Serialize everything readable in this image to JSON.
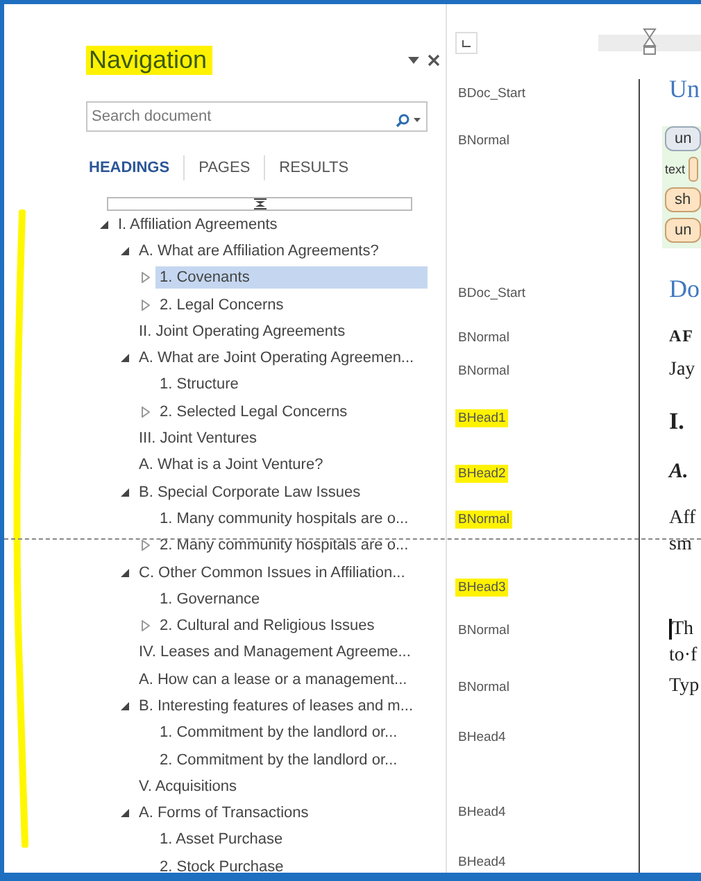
{
  "navigation": {
    "title": "Navigation",
    "title_highlighted": true,
    "search": {
      "placeholder": "Search document"
    },
    "tabs": [
      {
        "label": "HEADINGS",
        "selected": true
      },
      {
        "label": "PAGES",
        "selected": false
      },
      {
        "label": "RESULTS",
        "selected": false
      }
    ],
    "tree": [
      {
        "label": "I. Affiliation Agreements",
        "expanded": true,
        "selected": false,
        "children": [
          {
            "label": "A. What are Affiliation Agreements?",
            "expanded": true,
            "selected": false,
            "children": [
              {
                "label": "1. Covenants",
                "expanded": false,
                "selected": true
              },
              {
                "label": "2. Legal Concerns",
                "expanded": false,
                "selected": false
              }
            ]
          },
          {
            "label": "II. Joint Operating Agreements",
            "selected": false
          },
          {
            "label": "A. What are Joint Operating Agreemen...",
            "expanded": true,
            "selected": false,
            "children": [
              {
                "label": "1. Structure",
                "selected": false
              },
              {
                "label": "2. Selected Legal Concerns",
                "expanded": false,
                "selected": false
              }
            ]
          },
          {
            "label": "III. Joint Ventures",
            "selected": false
          },
          {
            "label": "A. What is a Joint Venture?",
            "selected": false
          },
          {
            "label": "B. Special Corporate Law Issues",
            "expanded": true,
            "selected": false,
            "children": [
              {
                "label": "1. Many community hospitals are o...",
                "selected": false
              },
              {
                "label": "2. Many community hospitals are o...",
                "expanded": false,
                "selected": false
              }
            ]
          },
          {
            "label": "C. Other Common Issues in Affiliation...",
            "expanded": true,
            "selected": false,
            "children": [
              {
                "label": "1. Governance",
                "selected": false
              },
              {
                "label": "2. Cultural and Religious Issues",
                "expanded": false,
                "selected": false
              }
            ]
          },
          {
            "label": "IV. Leases and Management Agreeme...",
            "selected": false
          },
          {
            "label": "A. How can a lease or a management...",
            "selected": false
          },
          {
            "label": "B. Interesting features of leases and m...",
            "expanded": true,
            "selected": false,
            "children": [
              {
                "label": "1. Commitment by the landlord or...",
                "selected": false
              },
              {
                "label": "2. Commitment by the landlord or...",
                "selected": false
              }
            ]
          },
          {
            "label": "V. Acquisitions",
            "selected": false
          },
          {
            "label": "A. Forms of Transactions",
            "expanded": true,
            "selected": false,
            "children": [
              {
                "label": "1. Asset Purchase",
                "selected": false
              },
              {
                "label": "2. Stock Purchase",
                "selected": false
              }
            ]
          }
        ]
      }
    ]
  },
  "styles_rows": [
    {
      "style": "BDoc_Start",
      "highlighted": false,
      "doc": {
        "kind": "heading",
        "lines": [
          "Un"
        ]
      }
    },
    {
      "style": "BNormal",
      "highlighted": false,
      "doc": {
        "kind": "tags",
        "tags": [
          {
            "text": "un",
            "color": "#e4e9ef"
          },
          {
            "label": "text",
            "color": "#fde3c2"
          },
          {
            "text": "sh",
            "color": "#fde3c2"
          },
          {
            "text": "un",
            "color": "#fde3c2"
          }
        ]
      }
    },
    {
      "style": "BDoc_Start",
      "highlighted": false,
      "doc": {
        "kind": "heading",
        "lines": [
          "Do"
        ]
      }
    },
    {
      "style": "BNormal",
      "highlighted": false,
      "doc": {
        "kind": "smallcaps",
        "lines": [
          "AF"
        ]
      }
    },
    {
      "style": "BNormal",
      "highlighted": false,
      "doc": {
        "kind": "body",
        "lines": [
          "Jay"
        ]
      }
    },
    {
      "style": "BHead1",
      "highlighted": true,
      "doc": {
        "kind": "bold",
        "lines": [
          "I."
        ]
      }
    },
    {
      "style": "BHead2",
      "highlighted": true,
      "doc": {
        "kind": "bolditalic",
        "lines": [
          "A."
        ]
      }
    },
    {
      "style": "BNormal",
      "highlighted": true,
      "doc": {
        "kind": "body",
        "lines": [
          "Aff",
          "sm"
        ]
      }
    },
    {
      "style": "BHead3",
      "highlighted": true
    },
    {
      "style": "BNormal",
      "highlighted": false,
      "doc": {
        "kind": "body",
        "cursor": true,
        "lines": [
          "Th",
          "to·f"
        ]
      }
    },
    {
      "style": "BNormal",
      "highlighted": false,
      "doc": {
        "kind": "body",
        "lines": [
          "Typ"
        ]
      }
    },
    {
      "style": "BHead4",
      "highlighted": false
    },
    {
      "style": "BHead4",
      "highlighted": false
    },
    {
      "style": "BHead4",
      "highlighted": false
    }
  ]
}
